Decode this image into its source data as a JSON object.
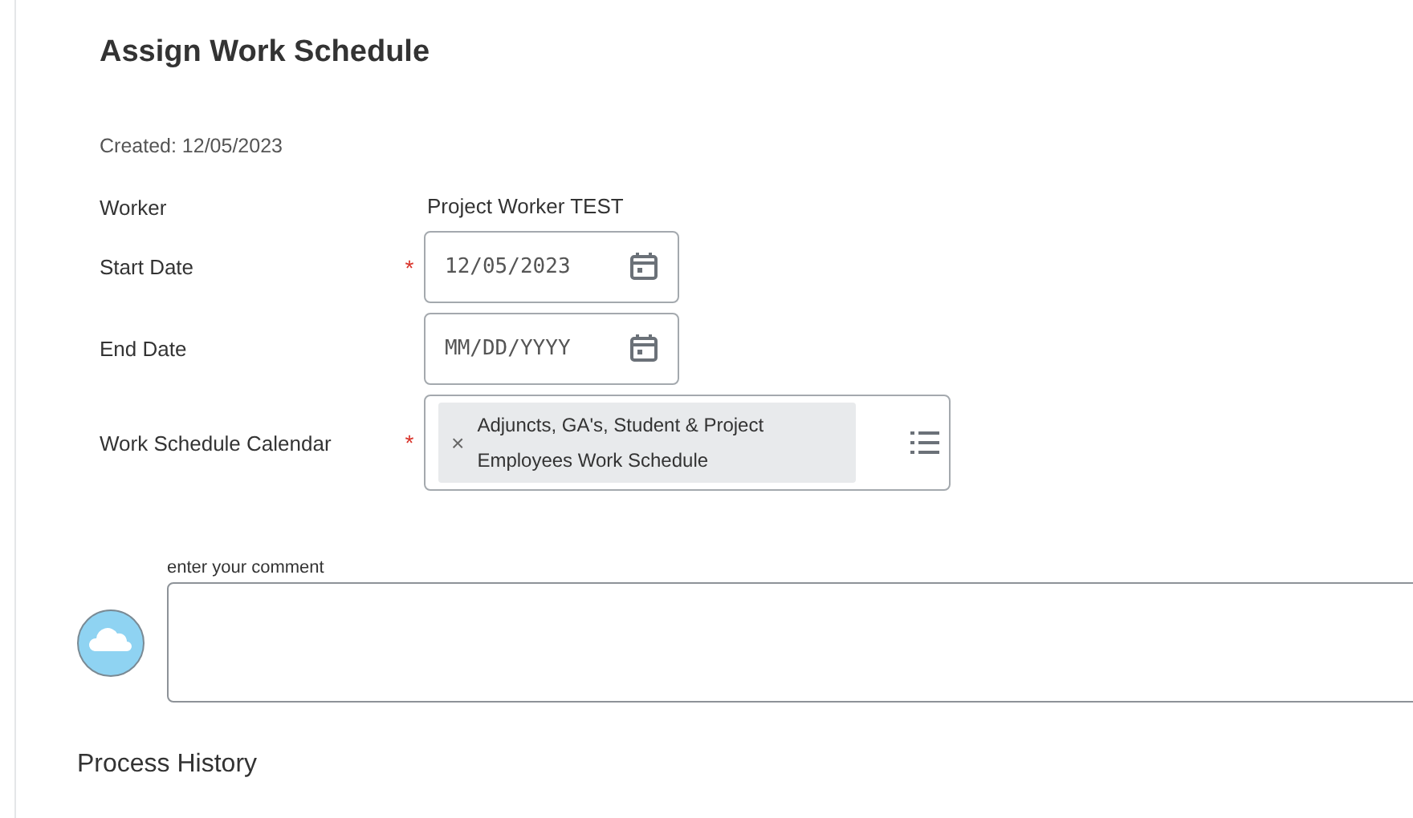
{
  "title": "Assign Work Schedule",
  "created": "Created: 12/05/2023",
  "fields": [
    {
      "kind": "text",
      "label": "Worker",
      "required": false,
      "value": "Project Worker TEST"
    },
    {
      "kind": "date",
      "label": "Start Date",
      "required": true,
      "value": "12/05/2023"
    },
    {
      "kind": "date",
      "label": "End Date",
      "required": false,
      "placeholder": "MM/DD/YYYY"
    },
    {
      "kind": "multiselect",
      "label": "Work Schedule Calendar",
      "required": true,
      "value": "Adjuncts, GA's, Student & Project Employees Work Schedule"
    }
  ],
  "required_mark": "*",
  "remove_mark": "×",
  "comment": {
    "label": "enter your comment"
  },
  "section_heading": "Process History"
}
